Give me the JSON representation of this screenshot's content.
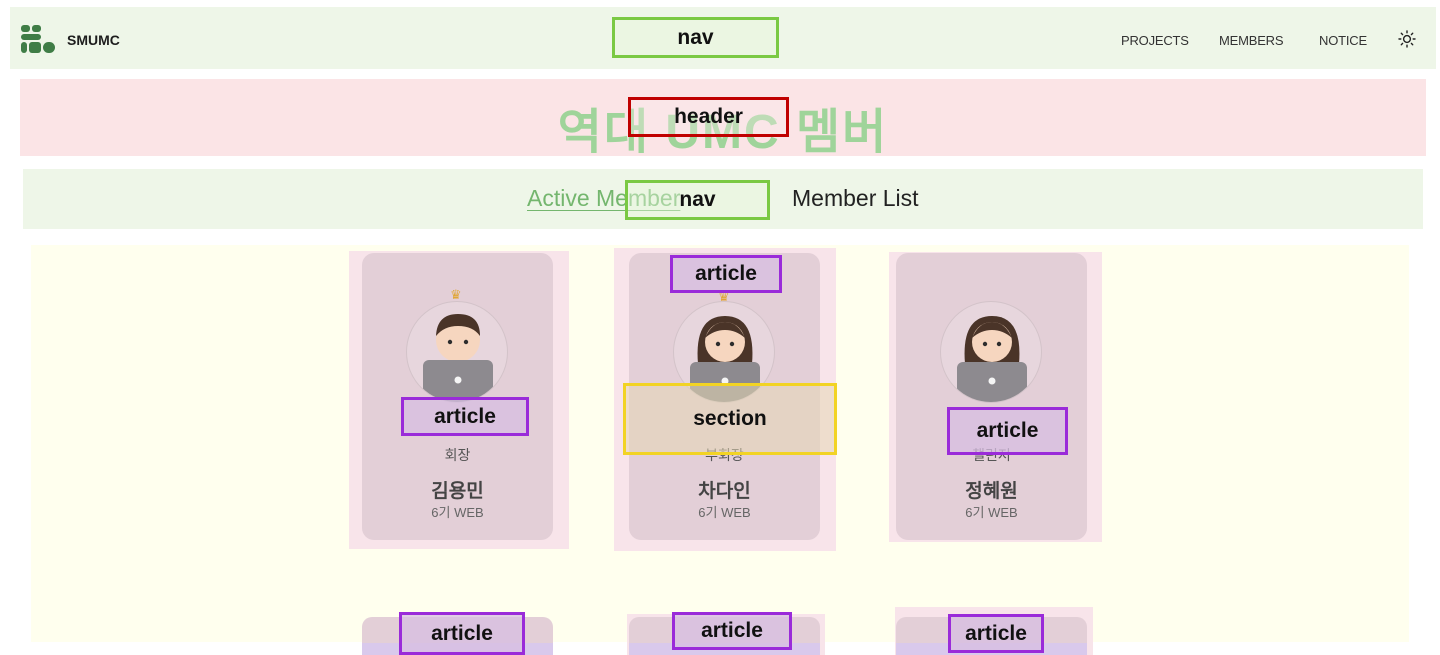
{
  "nav": {
    "brand": "SMUMC",
    "menu": [
      "PROJECTS",
      "MEMBERS",
      "NOTICE"
    ]
  },
  "header": {
    "title": "역대 UMC 멤버"
  },
  "tabs": {
    "active": "Active Member",
    "list": "Member List"
  },
  "members": [
    {
      "role": "회장",
      "name": "김용민",
      "gen": "6기 WEB",
      "crown": "♛"
    },
    {
      "role": "부회장",
      "name": "차다인",
      "gen": "6기 WEB",
      "crown": "♛"
    },
    {
      "role": "챌린저",
      "name": "정혜원",
      "gen": "6기 WEB",
      "crown": ""
    }
  ],
  "annotations": {
    "nav_top": "nav",
    "header": "header",
    "nav_sub": "nav",
    "article": "article",
    "section": "section"
  }
}
